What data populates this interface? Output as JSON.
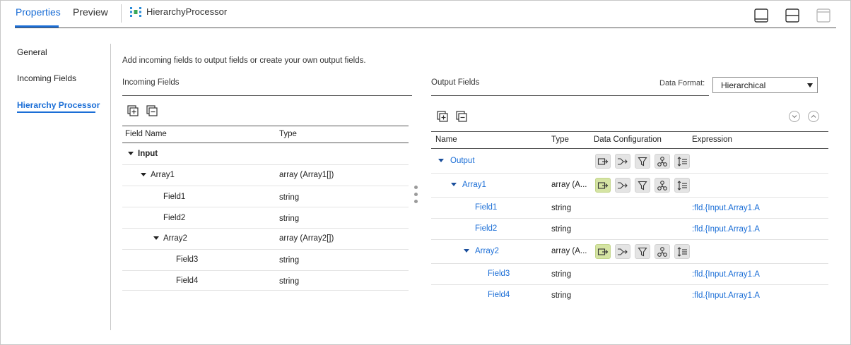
{
  "tabs": {
    "properties": "Properties",
    "preview": "Preview"
  },
  "transformation": {
    "title": "HierarchyProcessor"
  },
  "nav": {
    "general": "General",
    "incoming_fields": "Incoming Fields",
    "hierarchy_processor": "Hierarchy Processor"
  },
  "instruction": "Add incoming fields to output fields or create your own output fields.",
  "incoming": {
    "title": "Incoming Fields",
    "col_field_name": "Field Name",
    "col_type": "Type",
    "rows": [
      {
        "name": "Input",
        "type": ""
      },
      {
        "name": "Array1",
        "type": "array (Array1[])"
      },
      {
        "name": "Field1",
        "type": "string"
      },
      {
        "name": "Field2",
        "type": "string"
      },
      {
        "name": "Array2",
        "type": "array (Array2[])"
      },
      {
        "name": "Field3",
        "type": "string"
      },
      {
        "name": "Field4",
        "type": "string"
      }
    ]
  },
  "output": {
    "title": "Output Fields",
    "data_format_label": "Data Format:",
    "data_format_value": "Hierarchical",
    "col_name": "Name",
    "col_type": "Type",
    "col_data_config": "Data Configuration",
    "col_expression": "Expression",
    "rows": [
      {
        "name": "Output",
        "type": "",
        "expression": ""
      },
      {
        "name": "Array1",
        "type": "array (A...",
        "expression": ""
      },
      {
        "name": "Field1",
        "type": "string",
        "expression": ":fld.{Input.Array1.A"
      },
      {
        "name": "Field2",
        "type": "string",
        "expression": ":fld.{Input.Array1.A"
      },
      {
        "name": "Array2",
        "type": "array (A...",
        "expression": ""
      },
      {
        "name": "Field3",
        "type": "string",
        "expression": ":fld.{Input.Array1.A"
      },
      {
        "name": "Field4",
        "type": "string",
        "expression": ":fld.{Input.Array1.A"
      }
    ]
  },
  "icons": {
    "tool_add": "add-field-icon",
    "tool_remove": "remove-field-icon",
    "dc_buttons": [
      "input-field-icon",
      "map-icon",
      "filter-icon",
      "join-icon",
      "sort-icon"
    ]
  },
  "colors": {
    "accent": "#1b6ed6",
    "active_config": "#d5e4a3"
  }
}
